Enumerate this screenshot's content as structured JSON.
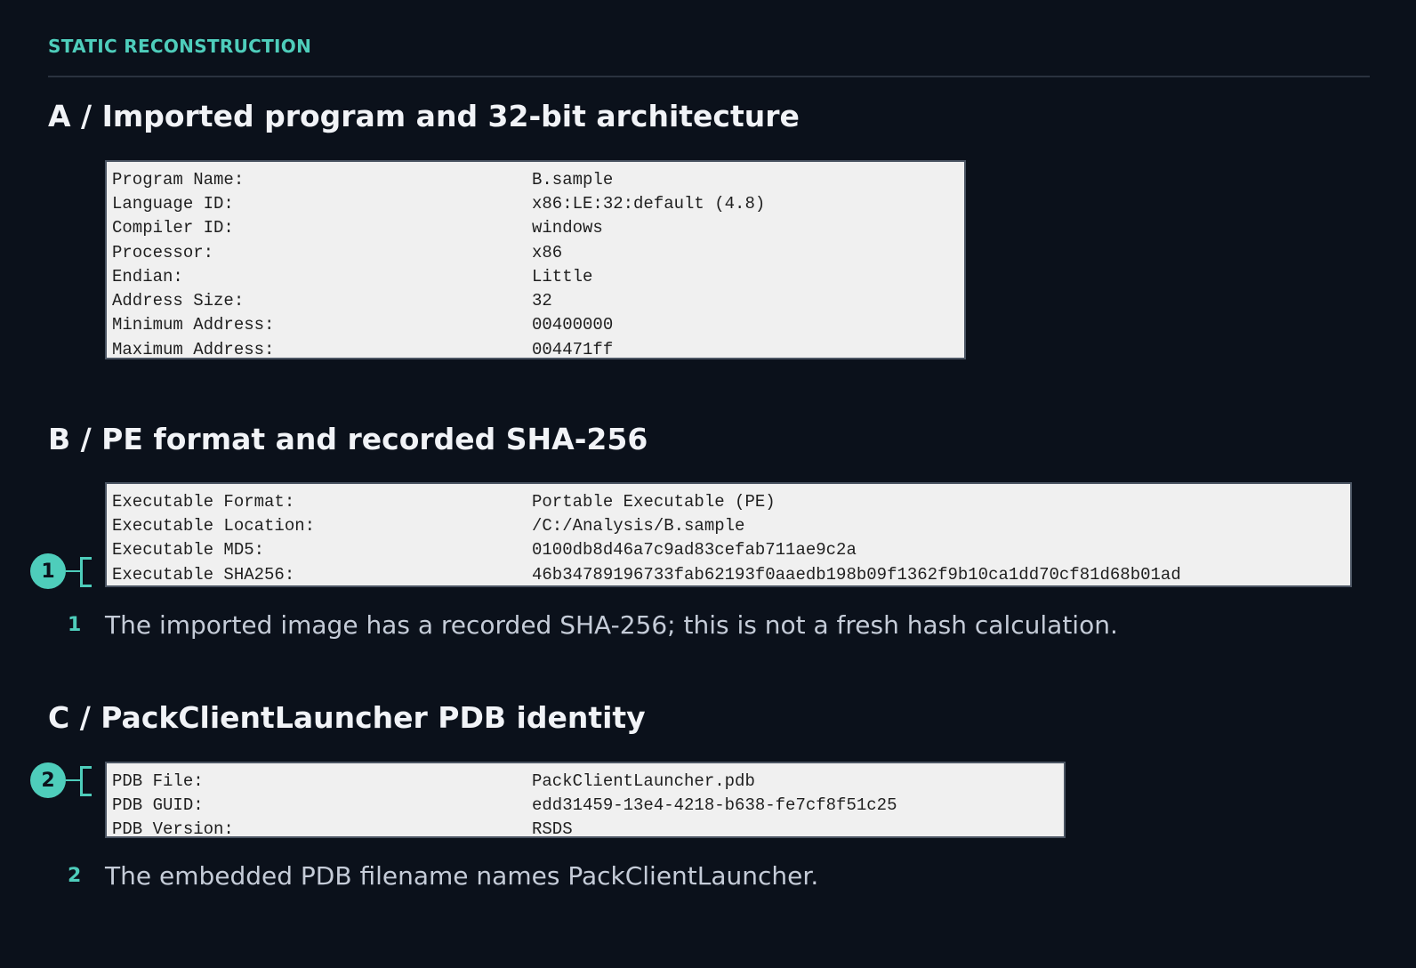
{
  "eyebrow": "STATIC RECONSTRUCTION",
  "sections": {
    "a": {
      "title": "A / Imported program and 32-bit architecture",
      "rows": [
        {
          "key": "Program Name:",
          "value": "B.sample"
        },
        {
          "key": "Language ID:",
          "value": "x86:LE:32:default (4.8)"
        },
        {
          "key": "Compiler ID:",
          "value": "windows"
        },
        {
          "key": "Processor:",
          "value": "x86"
        },
        {
          "key": "Endian:",
          "value": "Little"
        },
        {
          "key": "Address Size:",
          "value": "32"
        },
        {
          "key": "Minimum Address:",
          "value": "00400000"
        },
        {
          "key": "Maximum Address:",
          "value": "004471ff"
        }
      ]
    },
    "b": {
      "title": "B / PE format and recorded SHA-256",
      "rows": [
        {
          "key": "Executable Format:",
          "value": "Portable Executable (PE)"
        },
        {
          "key": "Executable Location:",
          "value": "/C:/Analysis/B.sample"
        },
        {
          "key": "Executable MD5:",
          "value": "0100db8d46a7c9ad83cefab711ae9c2a"
        },
        {
          "key": "Executable SHA256:",
          "value": "46b34789196733fab62193f0aaedb198b09f1362f9b10ca1dd70cf81d68b01ad"
        }
      ],
      "marker": "1",
      "note_num": "1",
      "note": "The imported image has a recorded SHA-256; this is not a fresh hash calculation."
    },
    "c": {
      "title": "C / PackClientLauncher PDB identity",
      "rows": [
        {
          "key": "PDB File:",
          "value": "PackClientLauncher.pdb"
        },
        {
          "key": "PDB GUID:",
          "value": "edd31459-13e4-4218-b638-fe7cf8f51c25"
        },
        {
          "key": "PDB Version:",
          "value": "RSDS"
        }
      ],
      "marker": "2",
      "note_num": "2",
      "note": "The embedded PDB filename names PackClientLauncher."
    }
  },
  "colors": {
    "background": "#0b111b",
    "accent": "#4ecdbb",
    "panel": "#f0f0f0"
  }
}
